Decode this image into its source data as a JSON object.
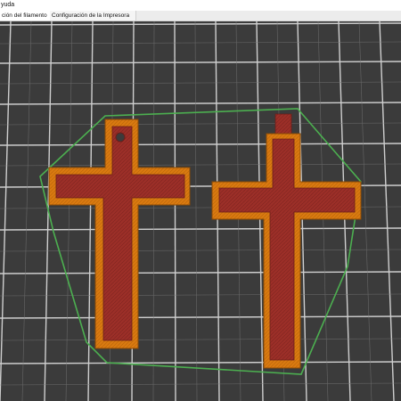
{
  "menubar": {
    "items": [
      {
        "label": "yuda"
      }
    ]
  },
  "tabs": [
    {
      "label": "ción del filamento",
      "active": true
    },
    {
      "label": "Configuración de la Impresora",
      "active": false
    }
  ],
  "viewport": {
    "background": "#3b3b3b",
    "grid_color": "#c9c9c9",
    "hull_color": "#4caf50",
    "part_outline_color": "#d97a10",
    "part_fill_color": "#9c2f28"
  }
}
